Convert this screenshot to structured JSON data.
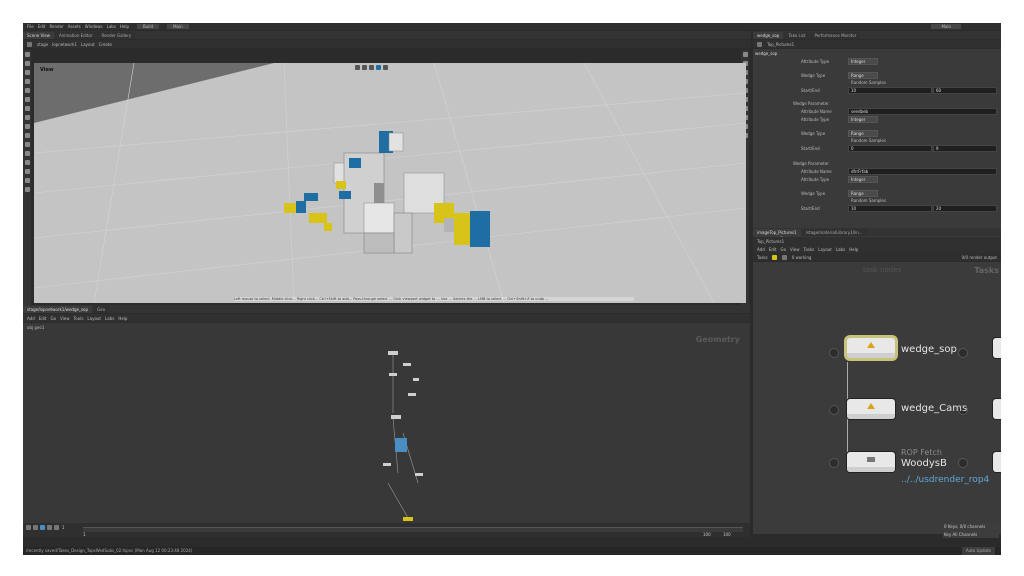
{
  "menubar": {
    "items": [
      "File",
      "Edit",
      "Render",
      "Assets",
      "Windows",
      "Labs",
      "Help"
    ],
    "desktop": "Build",
    "main": "Main",
    "right": "Main"
  },
  "viewer": {
    "tabs": [
      "Scene View",
      "Animation Editor",
      "Render Gallery"
    ],
    "path": [
      "stage",
      "lopnetwork1",
      "Layout",
      "Create"
    ],
    "title": "View",
    "status_text": "Left mouse to select. Middle click... Right click... Ctrl+Shift to add... Pass-through select ... Click viewport widget to ... Use ... Selects the ... LMB to select ... Ctrl+Shift+Z to undo ..."
  },
  "params": {
    "tabs": [
      "wedge_sop",
      "Take List",
      "Performance Monitor"
    ],
    "header_path": "Top_Pictures1",
    "node_name": "wedge_sop",
    "rows": [
      {
        "label": "Attribute Type",
        "value": "Integer"
      },
      {
        "label": "Wedge Type",
        "value": "Range"
      },
      {
        "label": "Random Samples",
        "value": ""
      },
      {
        "label": "Start/End",
        "v1": "10",
        "v2": "60"
      },
      {
        "label": "Wedge Parameter",
        "value": ""
      },
      {
        "label": "Attribute Name",
        "value": "seedbeb"
      },
      {
        "label": "Attribute Type",
        "value": "Integer"
      },
      {
        "label": "Wedge Type",
        "value": "Range"
      },
      {
        "label": "Random Samples",
        "value": ""
      },
      {
        "label": "Start/End",
        "v1": "0",
        "v2": "9"
      },
      {
        "label": "Wedge Parameter",
        "value": ""
      },
      {
        "label": "Attribute Name",
        "value": "dfrrFrfab"
      },
      {
        "label": "Attribute Type",
        "value": "Integer"
      },
      {
        "label": "Wedge Type",
        "value": "Range"
      },
      {
        "label": "Random Samples",
        "value": ""
      },
      {
        "label": "Start/End",
        "v1": "10",
        "v2": "20"
      }
    ],
    "footer": "Create Wedge Attribute"
  },
  "network": {
    "tabs": [
      "stage/lopnetwork1/wedge_sop",
      "Geo"
    ],
    "menu": [
      "Add",
      "Edit",
      "Go",
      "View",
      "Tools",
      "Layout",
      "Labs",
      "Help"
    ],
    "path": [
      "obj",
      "geo1"
    ],
    "label": "Geometry"
  },
  "tasks": {
    "tabs": [
      "imageTop_Pictures1",
      "/stage/materialLibrary1/lin..."
    ],
    "path_label": "Top_Pictures1",
    "menu": [
      "Add",
      "Edit",
      "Go",
      "View",
      "Tasks",
      "Layout",
      "Labs",
      "Help"
    ],
    "toolbar_label": "Tasks",
    "status": "0 working",
    "right_status": "0/0 render output",
    "header_faded": "task nodes",
    "header_right": "Tasks",
    "nodes": [
      {
        "name": "wedge_sop",
        "kind": "",
        "sub": ""
      },
      {
        "name": "wedge_Cams",
        "kind": "",
        "sub": ""
      },
      {
        "name": "WoodysB",
        "kind": "ROP Fetch",
        "sub": "../../usdrender_rop4"
      }
    ]
  },
  "timeline": {
    "frame": "1",
    "start": "1",
    "end": "100",
    "end2": "100"
  },
  "status": "/recently saved/Takes_Design_TopsWedSubs_02.hipnc (Mon Aug 12 00:23:48 2024)",
  "right_buttons": [
    "0 Keys, 0/0 channels",
    "Key All Channels",
    "Auto Update"
  ]
}
